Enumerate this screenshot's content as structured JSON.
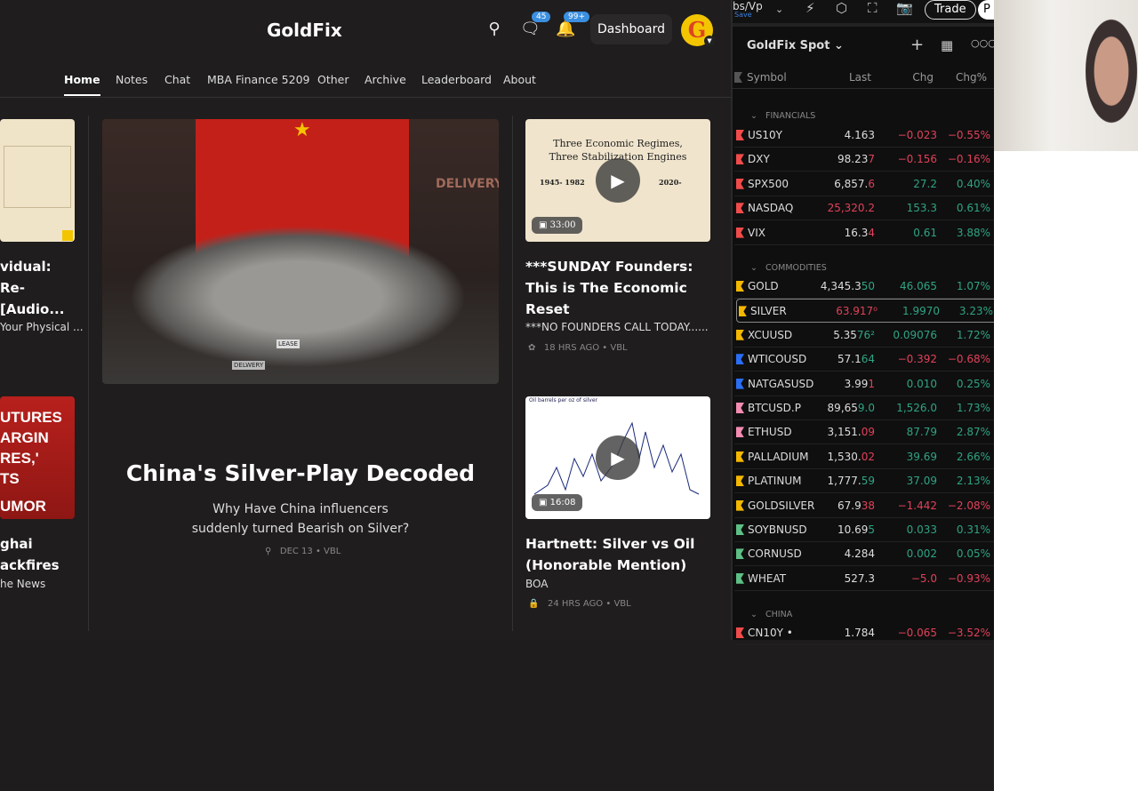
{
  "site": {
    "brand": "GoldFix",
    "badges": {
      "chat": "45",
      "notifications": "99+"
    },
    "dashboard": "Dashboard",
    "avatar_letter": "G",
    "nav": [
      "Home",
      "Notes",
      "Chat",
      "MBA Finance 5209",
      "Other",
      "Archive",
      "Leaderboard",
      "About"
    ],
    "left_posts": [
      {
        "title_lines": [
          "vidual:",
          "Re-",
          "[Audio..."
        ],
        "subtitle": "Your Physical ..."
      },
      {
        "thumb_lines": [
          "UTURES",
          "ARGIN",
          "RES,'",
          "TS",
          "UMOR"
        ],
        "title_lines": [
          "ghai",
          "ackfires"
        ],
        "subtitle": "he News"
      }
    ],
    "feature": {
      "title": "China's Silver-Play Decoded",
      "subtitle_lines": [
        "Why Have China influencers",
        "suddenly turned Bearish on Silver?"
      ],
      "meta": "DEC 13 • VBL",
      "thumb_labels": [
        "DELIVERY",
        "LEASE",
        "DELWERY"
      ]
    },
    "post1": {
      "thumb_title": [
        "Three Economic Regimes,",
        "Three Stabilization Engines"
      ],
      "cols": [
        "1945- 1982",
        "2020-"
      ],
      "duration": "33:00",
      "title_lines": [
        "***SUNDAY Founders:",
        "This is The Economic",
        "Reset"
      ],
      "subtitle": "***NO FOUNDERS CALL TODAY......",
      "meta": "18 HRS AGO • VBL"
    },
    "post2": {
      "thumb_caption": "Oil barrels per oz of silver",
      "duration": "16:08",
      "title_lines": [
        "Hartnett: Silver vs Oil",
        "(Honorable Mention)"
      ],
      "subtitle": "BOA",
      "meta": "24 HRS AGO • VBL"
    }
  },
  "watchlist": {
    "layout_label": "bs/Vp",
    "save": "Save",
    "trade": "Trade",
    "p_tab": "P",
    "title": "GoldFix Spot",
    "columns": [
      "Symbol",
      "Last",
      "Chg",
      "Chg%"
    ],
    "sections": [
      {
        "name": "FINANCIALS",
        "rows": [
          {
            "sym": "US10Y",
            "flag": "#f04b4b",
            "last": "4.163",
            "tail": "",
            "td": "",
            "chg": "−0.023",
            "pct": "−0.55%",
            "dir": "dn"
          },
          {
            "sym": "DXY",
            "flag": "#f04b4b",
            "last": "98.23",
            "tail": "7",
            "td": "dn",
            "chg": "−0.156",
            "pct": "−0.16%",
            "dir": "dn"
          },
          {
            "sym": "SPX500",
            "flag": "#f04b4b",
            "last": "6,857.",
            "tail": "6",
            "td": "dn",
            "chg": "27.2",
            "pct": "0.40%",
            "dir": "up"
          },
          {
            "sym": "NASDAQ",
            "flag": "#f04b4b",
            "last": "",
            "tail": "25,320.2",
            "td": "dn",
            "chg": "153.3",
            "pct": "0.61%",
            "dir": "up"
          },
          {
            "sym": "VIX",
            "flag": "#f04b4b",
            "last": "16.3",
            "tail": "4",
            "td": "dn",
            "chg": "0.61",
            "pct": "3.88%",
            "dir": "up"
          }
        ]
      },
      {
        "name": "COMMODITIES",
        "rows": [
          {
            "sym": "GOLD",
            "flag": "#f5b800",
            "last": "4,345.3",
            "tail": "50",
            "td": "up",
            "chg": "46.065",
            "pct": "1.07%",
            "dir": "up"
          },
          {
            "sym": "SILVER",
            "flag": "#f5b800",
            "last": "",
            "tail": "63.917⁰",
            "td": "dn",
            "chg": "1.9970",
            "pct": "3.23%",
            "dir": "up",
            "selected": true
          },
          {
            "sym": "XCUUSD",
            "flag": "#f5b800",
            "last": "5.35",
            "tail": "76²",
            "td": "up",
            "chg": "0.09076",
            "pct": "1.72%",
            "dir": "up"
          },
          {
            "sym": "WTICOUSD",
            "flag": "#2b6ef5",
            "last": "57.1",
            "tail": "64",
            "td": "up",
            "chg": "−0.392",
            "pct": "−0.68%",
            "dir": "dn"
          },
          {
            "sym": "NATGASUSD",
            "flag": "#2b6ef5",
            "last": "3.99",
            "tail": "1",
            "td": "dn",
            "chg": "0.010",
            "pct": "0.25%",
            "dir": "up"
          },
          {
            "sym": "BTCUSD.P",
            "flag": "#f28cb0",
            "last": "89,65",
            "tail": "9.0",
            "td": "up",
            "chg": "1,526.0",
            "pct": "1.73%",
            "dir": "up"
          },
          {
            "sym": "ETHUSD",
            "flag": "#f28cb0",
            "last": "3,151.",
            "tail": "09",
            "td": "dn",
            "chg": "87.79",
            "pct": "2.87%",
            "dir": "up"
          },
          {
            "sym": "PALLADIUM",
            "flag": "#f5b800",
            "last": "1,530.",
            "tail": "02",
            "td": "dn",
            "chg": "39.69",
            "pct": "2.66%",
            "dir": "up"
          },
          {
            "sym": "PLATINUM",
            "flag": "#f5b800",
            "last": "1,777.",
            "tail": "59",
            "td": "up",
            "chg": "37.09",
            "pct": "2.13%",
            "dir": "up"
          },
          {
            "sym": "GOLDSILVER",
            "flag": "#f5b800",
            "last": "67.9",
            "tail": "38",
            "td": "dn",
            "chg": "−1.442",
            "pct": "−2.08%",
            "dir": "dn"
          },
          {
            "sym": "SOYBNUSD",
            "flag": "#5dbf85",
            "last": "10.69",
            "tail": "5",
            "td": "up",
            "chg": "0.033",
            "pct": "0.31%",
            "dir": "up"
          },
          {
            "sym": "CORNUSD",
            "flag": "#5dbf85",
            "last": "4.284",
            "tail": "",
            "td": "",
            "chg": "0.002",
            "pct": "0.05%",
            "dir": "up"
          },
          {
            "sym": "WHEAT",
            "flag": "#5dbf85",
            "last": "527.3",
            "tail": "",
            "td": "",
            "chg": "−5.0",
            "pct": "−0.93%",
            "dir": "dn"
          }
        ]
      },
      {
        "name": "CHINA",
        "rows": [
          {
            "sym": "CN10Y •",
            "flag": "#f04b4b",
            "last": "1.784",
            "tail": "",
            "td": "",
            "chg": "−0.065",
            "pct": "−3.52%",
            "dir": "dn"
          }
        ]
      }
    ]
  }
}
